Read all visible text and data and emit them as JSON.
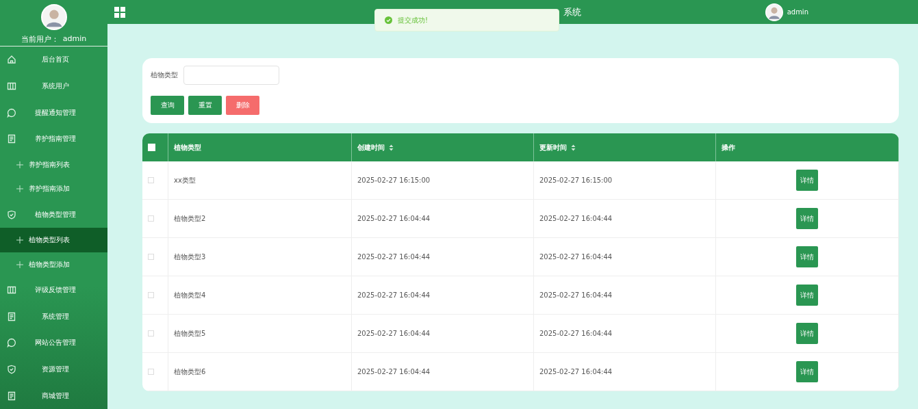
{
  "sidebar": {
    "user_label": "当前用户：",
    "user_name": "admin",
    "items": [
      {
        "kind": "menu",
        "label": "后台首页",
        "selected": false
      },
      {
        "kind": "menu",
        "label": "系统用户",
        "selected": false
      },
      {
        "kind": "menu",
        "label": "提醒通知管理",
        "selected": false
      },
      {
        "kind": "menu",
        "label": "养护指南管理",
        "selected": false
      },
      {
        "kind": "sub",
        "label": "养护指南列表",
        "selected": false
      },
      {
        "kind": "sub",
        "label": "养护指南添加",
        "selected": false
      },
      {
        "kind": "menu",
        "label": "植物类型管理",
        "selected": false
      },
      {
        "kind": "sub",
        "label": "植物类型列表",
        "selected": true
      },
      {
        "kind": "sub",
        "label": "植物类型添加",
        "selected": false
      },
      {
        "kind": "menu",
        "label": "评级反馈管理",
        "selected": false
      },
      {
        "kind": "menu",
        "label": "系统管理",
        "selected": false
      },
      {
        "kind": "menu",
        "label": "网站公告管理",
        "selected": false
      },
      {
        "kind": "menu",
        "label": "资源管理",
        "selected": false
      },
      {
        "kind": "menu",
        "label": "商城管理",
        "selected": false
      }
    ]
  },
  "header": {
    "title": "系统",
    "user_name": "admin"
  },
  "toast": {
    "message": "提交成功!"
  },
  "search": {
    "label": "植物类型",
    "buttons": [
      {
        "label": "查询",
        "kind": "primary"
      },
      {
        "label": "重置",
        "kind": "primary"
      },
      {
        "label": "删除",
        "kind": "danger"
      }
    ]
  },
  "table": {
    "select_all_checked": false,
    "columns": [
      {
        "label": "植物类型",
        "sortable": false
      },
      {
        "label": "创建时间",
        "sortable": true
      },
      {
        "label": "更新时间",
        "sortable": true
      },
      {
        "label": "操作",
        "sortable": false
      }
    ],
    "rows": [
      {
        "checked": false,
        "cells": [
          "xx类型",
          "2025-02-27 16:15:00",
          "2025-02-27 16:15:00"
        ],
        "action": "详情"
      },
      {
        "checked": false,
        "cells": [
          "植物类型2",
          "2025-02-27 16:04:44",
          "2025-02-27 16:04:44"
        ],
        "action": "详情"
      },
      {
        "checked": false,
        "cells": [
          "植物类型3",
          "2025-02-27 16:04:44",
          "2025-02-27 16:04:44"
        ],
        "action": "详情"
      },
      {
        "checked": false,
        "cells": [
          "植物类型4",
          "2025-02-27 16:04:44",
          "2025-02-27 16:04:44"
        ],
        "action": "详情"
      },
      {
        "checked": false,
        "cells": [
          "植物类型5",
          "2025-02-27 16:04:44",
          "2025-02-27 16:04:44"
        ],
        "action": "详情"
      },
      {
        "checked": false,
        "cells": [
          "植物类型6",
          "2025-02-27 16:04:44",
          "2025-02-27 16:04:44"
        ],
        "action": "详情"
      }
    ]
  }
}
